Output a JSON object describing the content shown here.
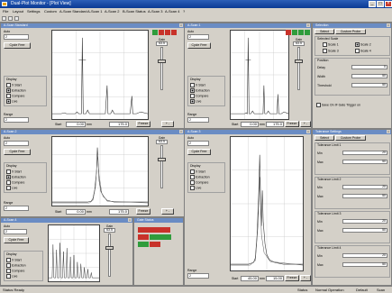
{
  "window": {
    "title": "Dual-Plot Monitor - [Plot View]"
  },
  "menu": [
    "File",
    "Layout",
    "Settings",
    "Custom",
    "A-Scan Standard",
    "A-Scan 1",
    "A-Scan 2",
    "B-Scan Status",
    "A-Scan 3",
    "A-Scan 4",
    "?"
  ],
  "status": {
    "left": "Status Ready",
    "r1": "Status",
    "r2": "Normal Operation",
    "r3": "Default",
    "r4": "Scan"
  },
  "common": {
    "units": "mm",
    "range_label": "Range",
    "freeze": "Freeze",
    "cycle_free": "Cycle Free",
    "display": "Display",
    "x_start": "X Start",
    "extraction": "Extraction",
    "compare": "Compare",
    "live": "Live",
    "auto_label": "Auto",
    "gain_label": "Gain",
    "width_label": "Width"
  },
  "panes": [
    {
      "title": "A-Scan Standard",
      "scale": "2",
      "left_val": "0.00",
      "right_val": "175.0",
      "gain": "63.5",
      "lights": [
        "green",
        "red",
        "red",
        "red"
      ]
    },
    {
      "title": "A-Scan 1",
      "scale": "2",
      "left_val": "0.00",
      "right_val": "175.0",
      "gain": "63.5",
      "lights": [
        "red",
        "green",
        "green",
        "green"
      ]
    },
    {
      "title": "A-Scan 2",
      "scale": "2",
      "left_val": "0.00",
      "right_val": "175.0",
      "gain": "63.5",
      "lights": []
    },
    {
      "title": "A-Scan 3",
      "scale": "2",
      "left_val": "45.00",
      "right_val": "15.00",
      "gain": "",
      "lights": []
    },
    {
      "title": "A-Scan 4",
      "scale": "2",
      "left_val": "",
      "right_val": "",
      "gain": "63.5",
      "lights": []
    }
  ],
  "gate_status": {
    "title": "Gate Status",
    "rows": [
      {
        "label": "Gate A",
        "state": "red"
      },
      {
        "label": "Gate B",
        "state": "green"
      },
      {
        "label": "Gate C",
        "state": "green"
      }
    ]
  },
  "right_panel_top": {
    "title": "Selection",
    "tabs": [
      "Select",
      "Custom Probe"
    ],
    "selected_scale_title": "Selected Scale",
    "options": [
      "Scale 1",
      "Scale 2",
      "Scale 3",
      "Scale 4"
    ],
    "position_title": "Position",
    "rows": [
      {
        "label": "Delay",
        "value": "0"
      },
      {
        "label": "Width",
        "value": "50"
      },
      {
        "label": "Threshold",
        "value": "50"
      }
    ],
    "checkbox": "Save On IF Gate Trigger on"
  },
  "right_panel_bottom": {
    "title": "Tolerance Settings",
    "tabs": [
      "Select",
      "Custom Probe"
    ],
    "sections": [
      {
        "title": "Tolerance Limit 1",
        "rows": [
          {
            "label": "Min",
            "value": "20"
          },
          {
            "label": "Max",
            "value": "50"
          }
        ]
      },
      {
        "title": "Tolerance Limit 2",
        "rows": [
          {
            "label": "Min",
            "value": "20"
          },
          {
            "label": "Max",
            "value": "50"
          }
        ]
      },
      {
        "title": "Tolerance Limit 3",
        "rows": [
          {
            "label": "Min",
            "value": "20"
          },
          {
            "label": "Max",
            "value": "50"
          }
        ]
      },
      {
        "title": "Tolerance Limit 4",
        "rows": [
          {
            "label": "Min",
            "value": "20"
          },
          {
            "label": "Max",
            "value": "50"
          }
        ]
      }
    ]
  }
}
